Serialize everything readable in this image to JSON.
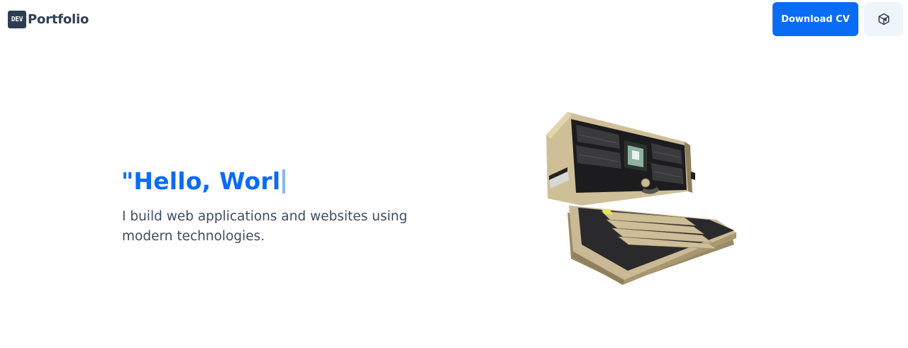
{
  "header": {
    "logo_badge": "DEV",
    "logo_text": "Portfolio",
    "download_label": "Download CV",
    "toggle_icon": "cube-icon"
  },
  "hero": {
    "title": "\"Hello, Worl",
    "subtitle": "I build web applications and websites using modern technologies.",
    "image": "retro-computer-3d-model"
  },
  "colors": {
    "accent": "#0a6cf5",
    "text": "#3d4d63",
    "logo_bg": "#2d3e54"
  }
}
